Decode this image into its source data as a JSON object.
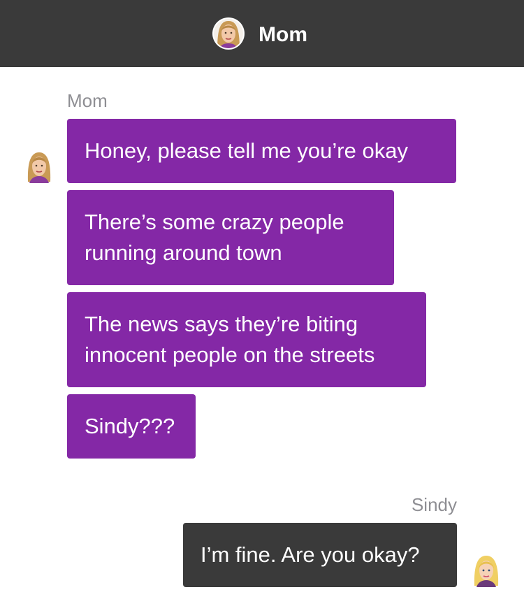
{
  "header": {
    "title": "Mom",
    "avatar_icon": "mom-avatar-icon"
  },
  "conversation": {
    "incoming": {
      "sender": "Mom",
      "bubble_color": "#8428a6",
      "messages": [
        {
          "lines": [
            "Honey, please tell me you’re okay"
          ]
        },
        {
          "lines": [
            "There’s some crazy people",
            "running around town"
          ]
        },
        {
          "lines": [
            "The news says they’re biting",
            "innocent people on the streets"
          ]
        },
        {
          "lines": [
            "Sindy???"
          ]
        }
      ]
    },
    "outgoing": {
      "sender": "Sindy",
      "bubble_color": "#3a3a3a",
      "messages": [
        {
          "lines": [
            "I’m fine. Are you okay?"
          ]
        }
      ]
    }
  },
  "colors": {
    "header_background": "#3a3a3a",
    "sender_label": "#8e8e93"
  }
}
